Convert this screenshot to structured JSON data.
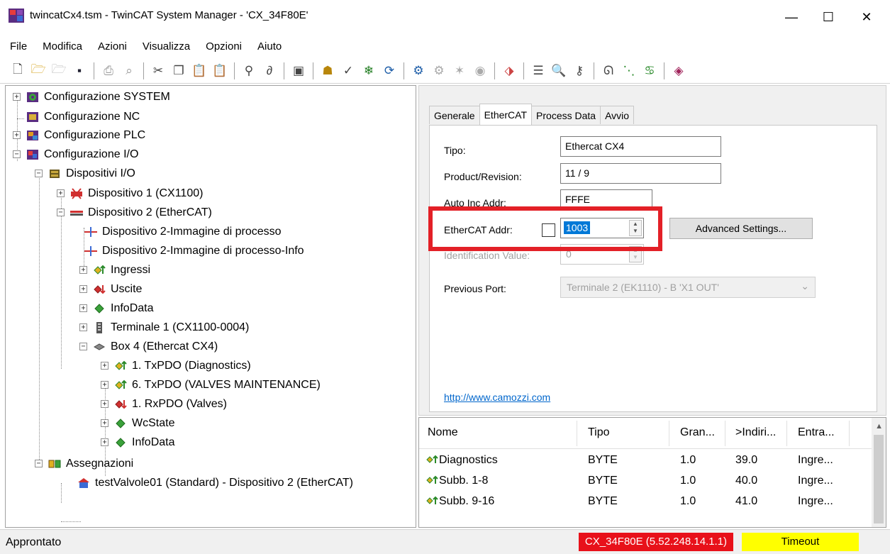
{
  "window": {
    "title": "twincatCx4.tsm - TwinCAT System Manager - 'CX_34F80E'",
    "minimize": "—",
    "maximize": "☐",
    "close": "✕"
  },
  "menu": [
    "File",
    "Modifica",
    "Azioni",
    "Visualizza",
    "Opzioni",
    "Aiuto"
  ],
  "toolbar": {
    "icons": [
      "new-icon",
      "open-icon",
      "open-disabled-icon",
      "save-icon",
      "print-icon",
      "print-preview-icon",
      "cut-icon",
      "copy-icon",
      "paste-icon",
      "paste-with-links-icon",
      "find-icon",
      "find-next-icon",
      "monitor-icon",
      "generate-mappings-icon",
      "check-configuration-icon",
      "activate-configuration-icon",
      "restart-system-icon",
      "set-run-mode-icon",
      "set-config-mode-icon",
      "reload-devices-icon",
      "scan-devices-icon",
      "toggle-free-run-icon",
      "show-online-data-icon",
      "tree-view-icon",
      "zoom-icon",
      "choose-target-icon",
      "watch-icon",
      "show-sub-items-icon",
      "online-sub-items-icon",
      "help-icon"
    ]
  },
  "tree": {
    "items": [
      {
        "label": "Configurazione SYSTEM",
        "icon": "system-config-icon"
      },
      {
        "label": "Configurazione NC",
        "icon": "nc-config-icon"
      },
      {
        "label": "Configurazione PLC",
        "icon": "plc-config-icon"
      },
      {
        "label": "Configurazione I/O",
        "icon": "io-config-icon"
      },
      {
        "label": "Dispositivi I/O",
        "icon": "io-devices-icon"
      },
      {
        "label": "Dispositivo 1 (CX1100)",
        "icon": "device-error-icon"
      },
      {
        "label": "Dispositivo 2 (EtherCAT)",
        "icon": "ethercat-device-icon"
      },
      {
        "label": "Dispositivo 2-Immagine di processo",
        "icon": "process-image-icon"
      },
      {
        "label": "Dispositivo 2-Immagine di processo-Info",
        "icon": "process-image-icon"
      },
      {
        "label": "Ingressi",
        "icon": "inputs-icon"
      },
      {
        "label": "Uscite",
        "icon": "outputs-icon"
      },
      {
        "label": "InfoData",
        "icon": "infodata-icon"
      },
      {
        "label": "Terminale 1 (CX1100-0004)",
        "icon": "terminal-icon"
      },
      {
        "label": "Box 4 (Ethercat CX4)",
        "icon": "box-icon"
      },
      {
        "label": "1. TxPDO (Diagnostics)",
        "icon": "inputs-icon"
      },
      {
        "label": "6. TxPDO (VALVES MAINTENANCE)",
        "icon": "inputs-icon"
      },
      {
        "label": "1. RxPDO (Valves)",
        "icon": "outputs-icon"
      },
      {
        "label": "WcState",
        "icon": "infodata-icon"
      },
      {
        "label": "InfoData",
        "icon": "infodata-icon"
      },
      {
        "label": "Assegnazioni",
        "icon": "mappings-icon"
      },
      {
        "label": "testValvole01 (Standard) - Dispositivo 2 (EtherCAT)",
        "icon": "mapping-link-icon"
      }
    ]
  },
  "tabs": [
    "Generale",
    "EtherCAT",
    "Process Data",
    "Avvio"
  ],
  "ethercat": {
    "tipo_label": "Tipo:",
    "tipo_value": "Ethercat CX4",
    "product_label": "Product/Revision:",
    "product_value": "11 / 9",
    "autoinc_label": "Auto Inc Addr:",
    "autoinc_value": "FFFE",
    "addr_label": "EtherCAT Addr:",
    "addr_value": "1003",
    "addr_checkbox_checked": false,
    "advanced_button": "Advanced Settings...",
    "ident_label": "Identification Value:",
    "ident_value": "0",
    "prev_port_label": "Previous Port:",
    "prev_port_value": "Terminale 2 (EK1110) - B 'X1 OUT'",
    "link": "http://www.camozzi.com",
    "highlight_color": "#e32027"
  },
  "table": {
    "columns": [
      "Nome",
      "Tipo",
      "Gran...",
      ">Indiri...",
      "Entra..."
    ],
    "rows": [
      {
        "nome": "Diagnostics",
        "tipo": "BYTE",
        "gran": "1.0",
        "indir": "39.0",
        "entra": "Ingre..."
      },
      {
        "nome": "Subb. 1-8",
        "tipo": "BYTE",
        "gran": "1.0",
        "indir": "40.0",
        "entra": "Ingre..."
      },
      {
        "nome": "Subb. 9-16",
        "tipo": "BYTE",
        "gran": "1.0",
        "indir": "41.0",
        "entra": "Ingre..."
      }
    ]
  },
  "status": {
    "text": "Approntato",
    "target": "CX_34F80E (5.52.248.14.1.1)",
    "target_color": "#e8111a",
    "timeout": "Timeout",
    "timeout_color": "#ffff00"
  }
}
